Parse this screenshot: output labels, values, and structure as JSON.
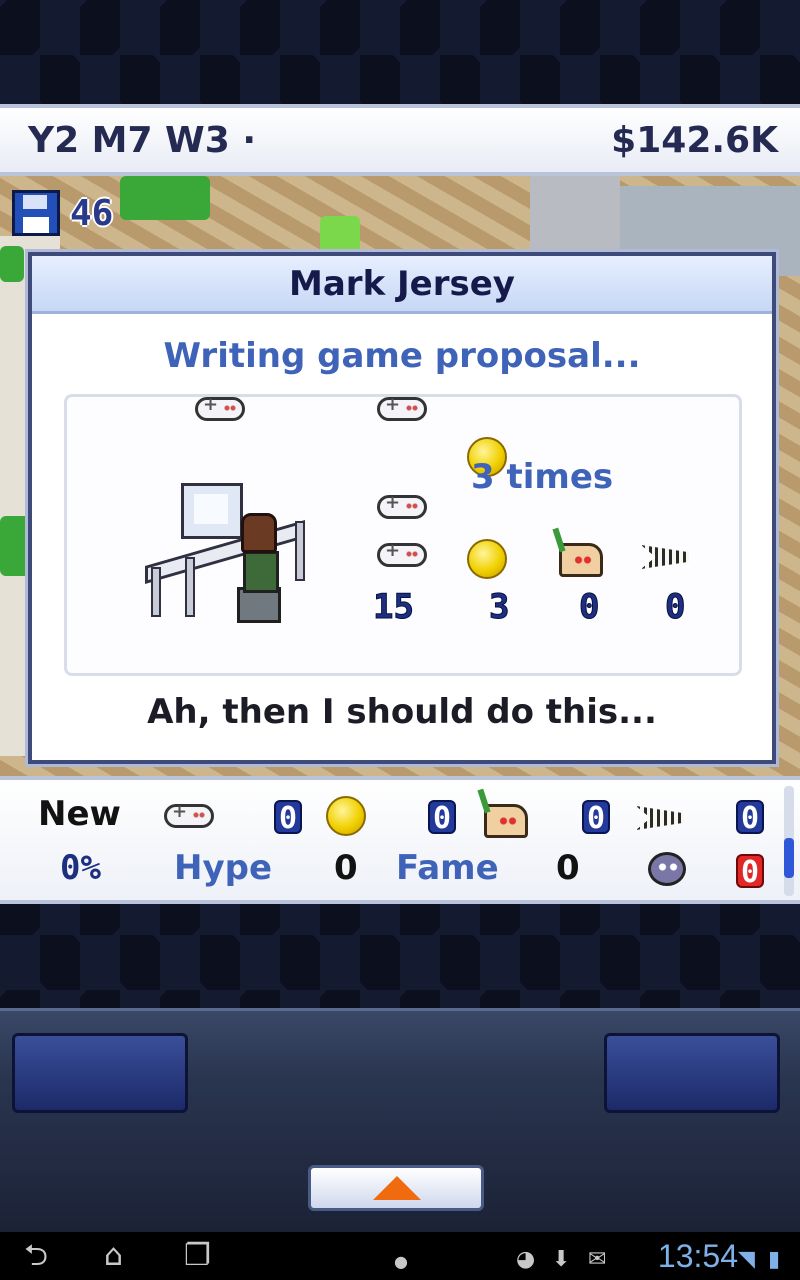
{
  "status_bar": {
    "date": "Y2 M7 W3",
    "date_marker": "·",
    "funds": "$142.6K"
  },
  "save": {
    "count": "46"
  },
  "dialog": {
    "title": "Mark Jersey",
    "status": "Writing game proposal...",
    "bonus_times": "3 times",
    "stats": {
      "fun": "15",
      "creativity": "3",
      "graphics": "0",
      "sound": "0"
    },
    "message": "Ah, then I should do this..."
  },
  "bottom_stats": {
    "type_label": "New",
    "fun": "0",
    "creativity": "0",
    "graphics": "0",
    "sound": "0",
    "progress": "0%",
    "hype_label": "Hype",
    "hype_value": "0",
    "fame_label": "Fame",
    "fame_value": "0",
    "bugs": "0"
  },
  "system": {
    "clock": "13:54"
  },
  "colors": {
    "accent_blue": "#3f63b8",
    "title_navy": "#151a4a",
    "bug_red": "#e02828",
    "arrow_orange": "#f06a10"
  }
}
